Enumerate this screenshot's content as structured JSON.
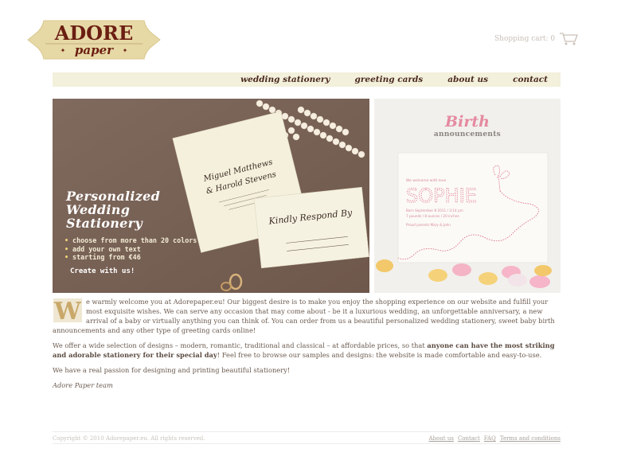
{
  "logo": {
    "line1": "ADORE",
    "line2": "paper"
  },
  "cart": {
    "label": "Shopping cart: 0",
    "icon": "shopping-cart-icon"
  },
  "nav": {
    "items": [
      {
        "label": "wedding stationery"
      },
      {
        "label": "greeting cards"
      },
      {
        "label": "about us"
      },
      {
        "label": "contact"
      }
    ]
  },
  "hero_left": {
    "title": "Personalized\nWedding\nStationery",
    "bullets": [
      "choose from more than 20 colors",
      "add your own text",
      "starting from €46"
    ],
    "cta": "Create with us!",
    "card_name": "Miguel Matthews & Harold Stevens",
    "reply_text": "Kindly Respond By"
  },
  "hero_right": {
    "title": "Birth",
    "subtitle": "announcements",
    "card_intro": "We welcome with love",
    "card_name": "SOPHIE",
    "card_details_1": "Born September 8 2011 / 3:14 pm",
    "card_details_2": "7 pounds / 8 ounces / 20 inches",
    "card_parents": "Proud parents Mary & John"
  },
  "welcome": {
    "dropcap": "W",
    "p1": "e warmly welcome you at Adorepaper.eu! Our biggest desire is to make you enjoy the shopping experience on our website and fulfill your most exquisite wishes. We can serve any occasion that may come about - be it a luxurious wedding, an unforgettable anniversary, a new arrival of a baby or virtually anything you can think of. You can order from us a beautiful personalized wedding stationery, sweet baby birth announcements and any other type of greeting cards online!",
    "p2_start": "We offer a wide selection of designs – modern, romantic, traditional and classical – at affordable prices, so that ",
    "p2_bold": "anyone can have the most striking and adorable stationery for their special day",
    "p2_end": "! Feel free to browse our samples and designs: the website is made comfortable and easy-to-use.",
    "p3": "We have a real passion for designing and printing beautiful stationery!",
    "signature": "Adore Paper team"
  },
  "footer": {
    "copyright": "Copyright © 2010 Adorepaper.eu. All rights reserved.",
    "links": [
      {
        "label": "About us"
      },
      {
        "label": "Contact"
      },
      {
        "label": "FAQ"
      },
      {
        "label": "Terms and conditions"
      }
    ]
  },
  "colors": {
    "logo_bg": "#e7d9a6",
    "logo_text": "#6b1e12",
    "nav_bg": "#f3f0db",
    "nav_text": "#4a2a1e",
    "hero_left_bg": "#7a6357",
    "birth_pink": "#e58aa0"
  }
}
